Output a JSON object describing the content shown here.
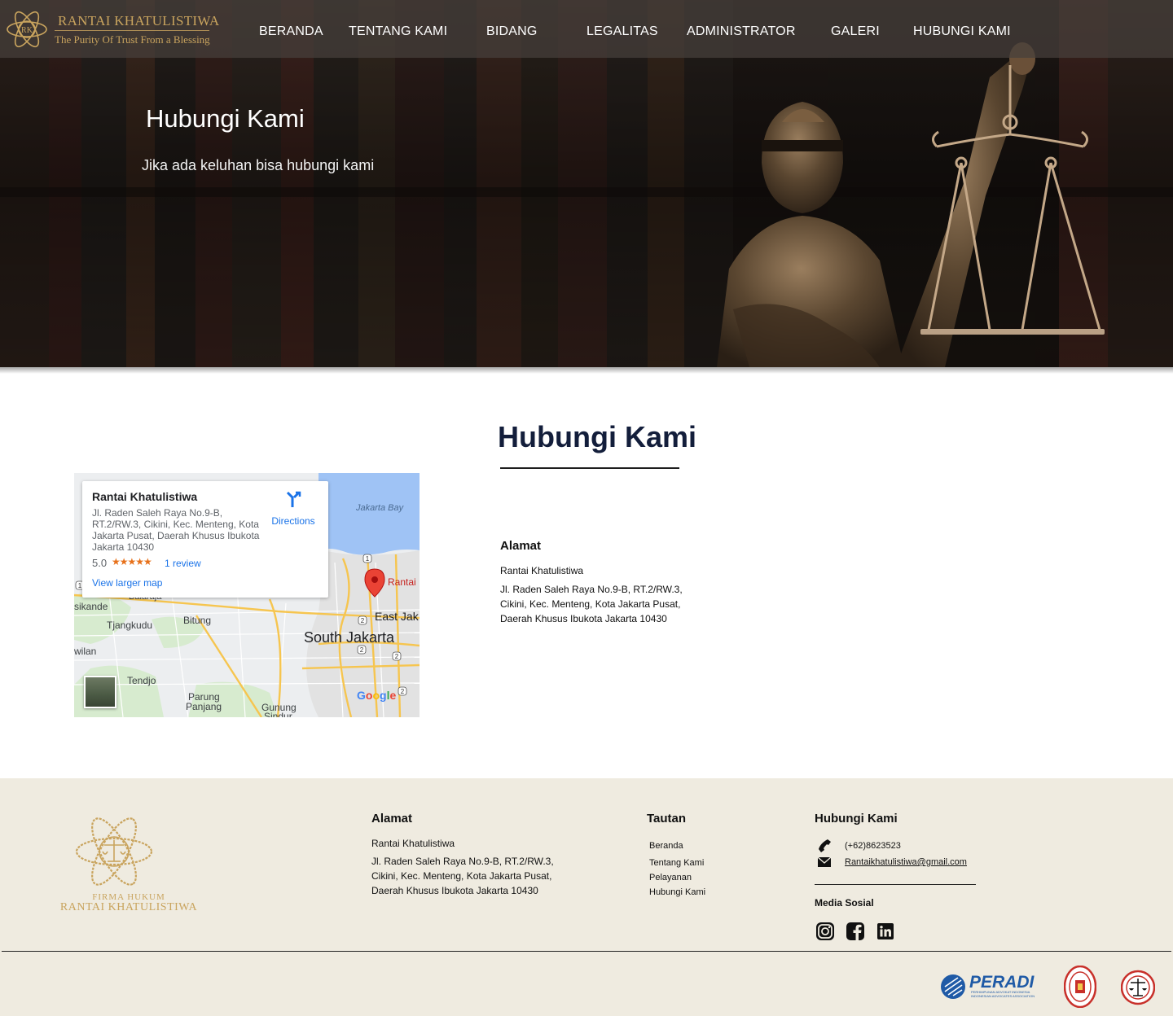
{
  "brand": {
    "name": "RANTAI KHATULISTIWA",
    "tagline": "The Purity Of Trust From a Blessing",
    "monogram": "RK",
    "gold": "#c9a45e"
  },
  "nav": {
    "items": [
      "BERANDA",
      "TENTANG KAMI",
      "BIDANG",
      "LEGALITAS",
      "ADMINISTRATOR",
      "GALERI",
      "HUBUNGI KAMI"
    ]
  },
  "hero": {
    "title": "Hubungi Kami",
    "subtitle": "Jika ada keluhan bisa hubungi kami"
  },
  "contact": {
    "title": "Hubungi Kami",
    "title_color": "#131e3b",
    "address_title": "Alamat",
    "address_name": "Rantai Khatulistiwa",
    "address_body": "Jl. Raden Saleh Raya No.9-B, RT.2/RW.3, Cikini, Kec. Menteng, Kota Jakarta Pusat, Daerah Khusus Ibukota Jakarta 10430"
  },
  "map": {
    "place_name": "Rantai Khatulistiwa",
    "place_address": "Jl. Raden Saleh Raya No.9-B, RT.2/RW.3, Cikini, Kec. Menteng, Kota Jakarta Pusat, Daerah Khusus Ibukota Jakarta 10430",
    "rating": "5.0",
    "stars": "★★★★★",
    "reviews": "1 review",
    "larger_map": "View larger map",
    "directions": "Directions",
    "labels": {
      "bay": "Jakarta Bay",
      "pin": "Rantai",
      "east": "East Jak",
      "south": "South Jakarta",
      "balaraja": "Balaraja",
      "sikande": "sikande",
      "tjangkudu": "Tjangkudu",
      "bitung": "Bitung",
      "wilan": "wilan",
      "tendjo": "Tendjo",
      "parung": "Parung",
      "panjang": "Panjang",
      "gunung": "Gunung",
      "sindur": "Sindur"
    },
    "road_markers": [
      "1",
      "1",
      "2",
      "2",
      "2",
      "2"
    ],
    "google": "Google"
  },
  "footer": {
    "logo_line1": "FIRMA HUKUM",
    "logo_line2": "RANTAI KHATULISTIWA",
    "address_title": "Alamat",
    "address_name": "Rantai Khatulistiwa",
    "address_body": "Jl. Raden Saleh Raya No.9-B, RT.2/RW.3, Cikini, Kec. Menteng, Kota Jakarta Pusat, Daerah Khusus Ibukota Jakarta 10430",
    "links_title": "Tautan",
    "links": [
      "Beranda",
      "Tentang Kami",
      "Pelayanan",
      "Hubungi Kami"
    ],
    "contact_title": "Hubungi Kami",
    "phone": "(+62)8623523",
    "email": "Rantaikhatulistiwa@gmail.com",
    "social_title": "Media Sosial",
    "social_icons": [
      "instagram-icon",
      "facebook-icon",
      "linkedin-icon"
    ],
    "partners": {
      "peradi": "PERADI",
      "peradi_sub1": "PERHIMPUNAN ADVOKAT INDONESIA",
      "peradi_sub2": "INDONESIAN ADVOCATES ASSOCIATION"
    },
    "bg": "#efebe0"
  }
}
